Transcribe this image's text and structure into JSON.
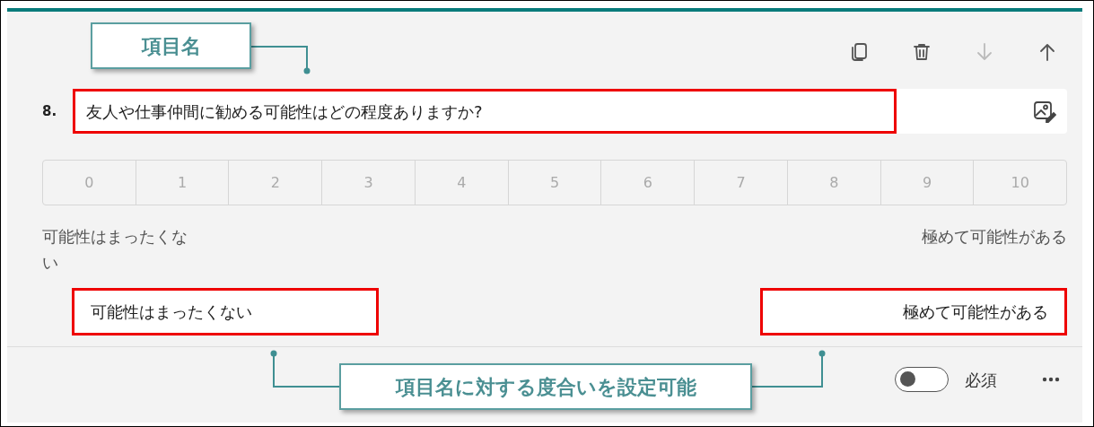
{
  "toolbar": [
    {
      "kind": "copy",
      "disabled": false
    },
    {
      "kind": "delete",
      "disabled": false
    },
    {
      "kind": "move-down",
      "disabled": true
    },
    {
      "kind": "move-up",
      "disabled": false
    }
  ],
  "question": {
    "number": "8.",
    "title": "友人や仕事仲間に勧める可能性はどの程度ありますか?"
  },
  "scale": [
    {
      "label": "0"
    },
    {
      "label": "1"
    },
    {
      "label": "2"
    },
    {
      "label": "3"
    },
    {
      "label": "4"
    },
    {
      "label": "5"
    },
    {
      "label": "6"
    },
    {
      "label": "7"
    },
    {
      "label": "8"
    },
    {
      "label": "9"
    },
    {
      "label": "10"
    }
  ],
  "scale_labels": {
    "left": "可能性はまったくない",
    "right": "極めて可能性がある"
  },
  "label_fields": [
    {
      "value": "可能性はまったくない"
    },
    {
      "value": "極めて可能性がある"
    }
  ],
  "footer": {
    "required": {
      "label": "必須",
      "on": false
    }
  },
  "callouts": [
    {
      "text": "項目名"
    },
    {
      "text": "項目名に対する度合いを設定可能"
    }
  ]
}
